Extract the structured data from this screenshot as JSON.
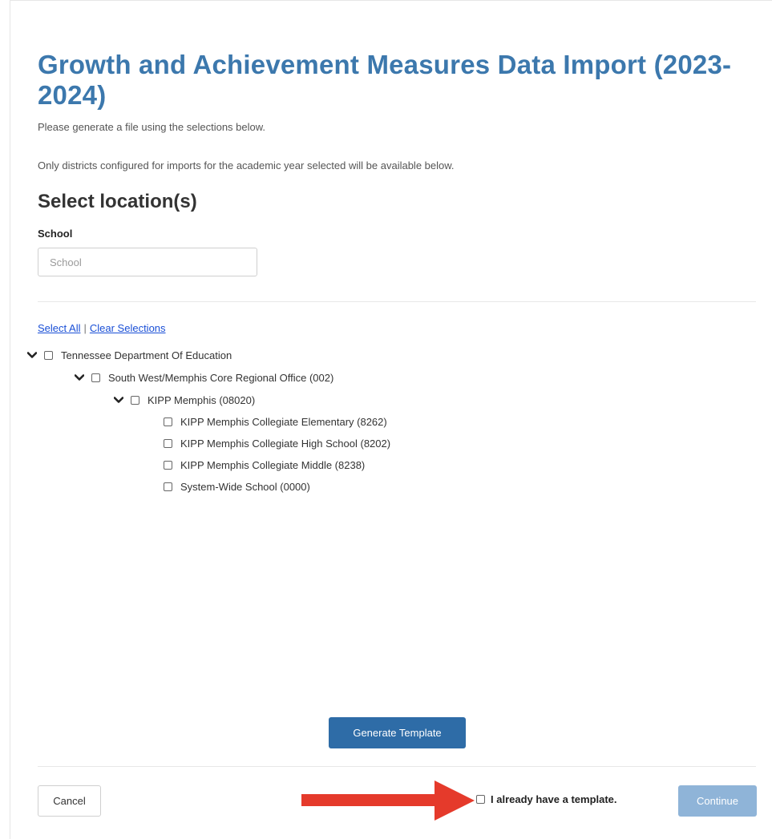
{
  "header": {
    "title": "Growth and Achievement Measures Data Import (2023-2024)",
    "instruction": "Please generate a file using the selections below.",
    "note": "Only districts configured for imports for the academic year selected will be available below."
  },
  "location": {
    "heading": "Select location(s)",
    "school_label": "School",
    "school_placeholder": "School",
    "school_value": ""
  },
  "selection_links": {
    "select_all": "Select All",
    "separator": "|",
    "clear": "Clear Selections"
  },
  "tree": [
    {
      "label": "Tennessee Department Of Education",
      "expandable": true,
      "checked": false
    },
    {
      "label": "South West/Memphis Core Regional Office (002)",
      "expandable": true,
      "checked": false
    },
    {
      "label": "KIPP Memphis (08020)",
      "expandable": true,
      "checked": false
    },
    {
      "label": "KIPP Memphis Collegiate Elementary (8262)",
      "expandable": false,
      "checked": false
    },
    {
      "label": "KIPP Memphis Collegiate High School (8202)",
      "expandable": false,
      "checked": false
    },
    {
      "label": "KIPP Memphis Collegiate Middle (8238)",
      "expandable": false,
      "checked": false
    },
    {
      "label": "System-Wide School (0000)",
      "expandable": false,
      "checked": false
    }
  ],
  "actions": {
    "generate_label": "Generate Template",
    "cancel_label": "Cancel",
    "template_label": "I already have a template.",
    "template_checked": false,
    "continue_label": "Continue"
  },
  "colors": {
    "title": "#3c78ad",
    "primary_button": "#2e6ca7",
    "disabled_button": "#8fb4d8",
    "link": "#1a4fd6",
    "annotation_arrow": "#e53a2b"
  },
  "icons": {
    "expand": "chevron-down-icon",
    "annotation": "red-arrow-icon"
  }
}
